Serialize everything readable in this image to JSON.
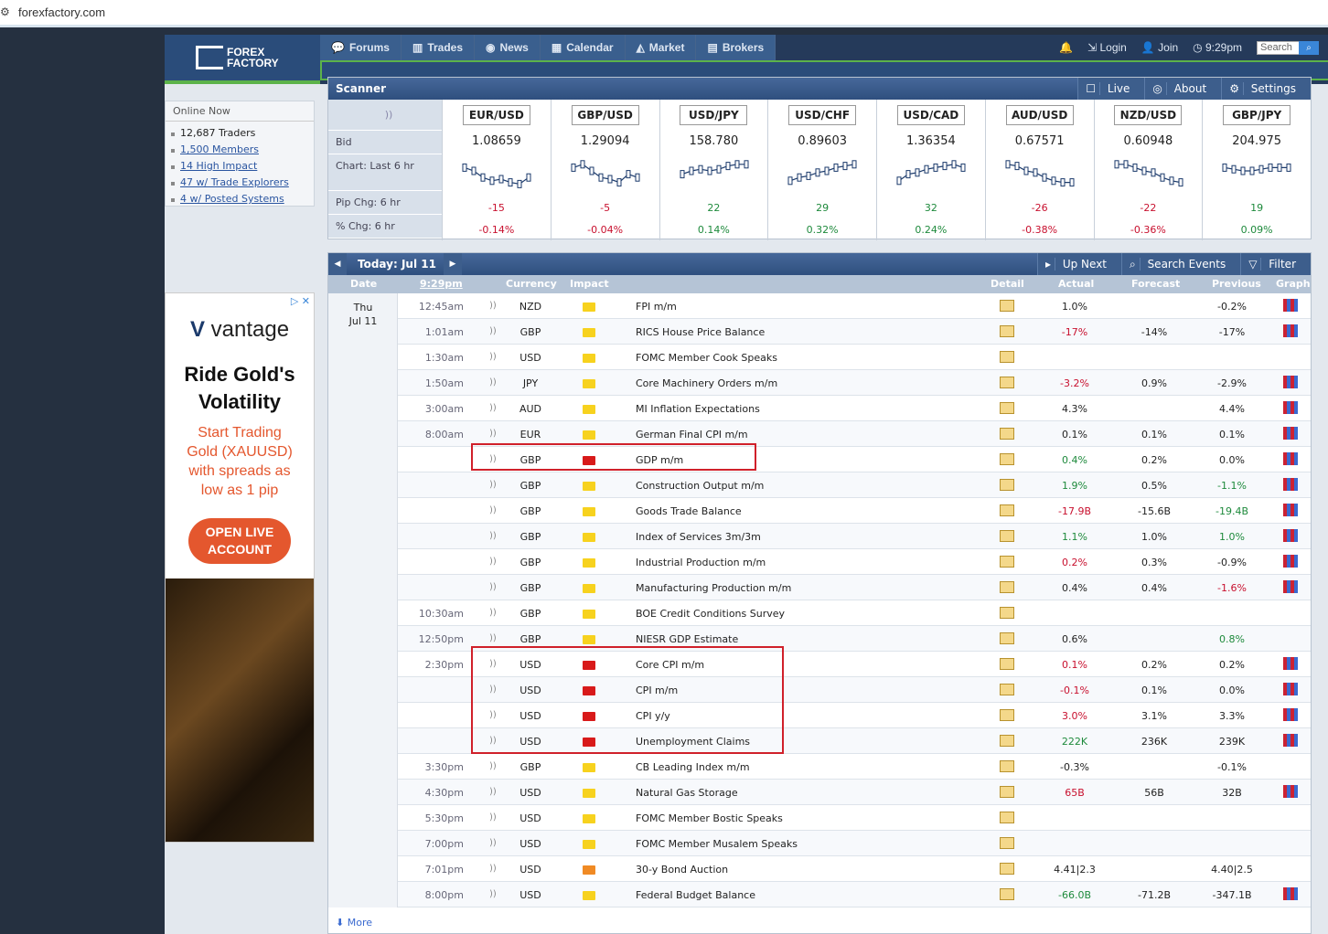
{
  "browser": {
    "url": "forexfactory.com"
  },
  "logo": {
    "line1": "FOREX",
    "line2": "FACTORY"
  },
  "nav": [
    {
      "label": "Forums",
      "icon": "chat-icon",
      "glyph": "💬"
    },
    {
      "label": "Trades",
      "icon": "bars-icon",
      "glyph": "▥"
    },
    {
      "label": "News",
      "icon": "globe-icon",
      "glyph": "◉"
    },
    {
      "label": "Calendar",
      "icon": "calendar-icon",
      "glyph": "▦"
    },
    {
      "label": "Market",
      "icon": "chart-icon",
      "glyph": "◭"
    },
    {
      "label": "Brokers",
      "icon": "brokers-icon",
      "glyph": "▤"
    }
  ],
  "user": {
    "login": "Login",
    "join": "Join",
    "time": "9:29pm",
    "search_placeholder": "Search"
  },
  "online": {
    "title": "Online Now",
    "items": [
      {
        "text": "12,687 Traders",
        "link": false
      },
      {
        "text": "1,500 Members",
        "link": true
      },
      {
        "text": "14 High Impact",
        "link": true
      },
      {
        "text": "47 w/ Trade Explorers",
        "link": true
      },
      {
        "text": "4 w/ Posted Systems",
        "link": true
      }
    ]
  },
  "ad": {
    "brand": "vantage",
    "headline1": "Ride Gold's",
    "headline2": "Volatility",
    "sub1": "Start Trading",
    "sub2": "Gold (XAUUSD)",
    "sub3": "with spreads as",
    "sub4": "low as 1 pip",
    "btn1": "OPEN LIVE",
    "btn2": "ACCOUNT"
  },
  "scanner": {
    "title": "Scanner",
    "live": "Live",
    "about": "About",
    "settings": "Settings",
    "labels": {
      "bid": "Bid",
      "chart": "Chart: Last 6 hr",
      "pip": "Pip Chg: 6 hr",
      "pct": "% Chg: 6 hr"
    },
    "pairs": [
      {
        "name": "EUR/USD",
        "bid": "1.08659",
        "pip": "-15",
        "pct": "-0.14%",
        "dir": "neg",
        "spark": [
          0.4,
          0.5,
          0.7,
          0.8,
          0.75,
          0.85,
          0.9,
          0.7
        ]
      },
      {
        "name": "GBP/USD",
        "bid": "1.29094",
        "pip": "-5",
        "pct": "-0.04%",
        "dir": "neg",
        "spark": [
          0.4,
          0.3,
          0.5,
          0.7,
          0.75,
          0.85,
          0.6,
          0.7
        ]
      },
      {
        "name": "USD/JPY",
        "bid": "158.780",
        "pip": "22",
        "pct": "0.14%",
        "dir": "pos",
        "spark": [
          0.6,
          0.5,
          0.45,
          0.5,
          0.45,
          0.35,
          0.3,
          0.3
        ]
      },
      {
        "name": "USD/CHF",
        "bid": "0.89603",
        "pip": "29",
        "pct": "0.32%",
        "dir": "pos",
        "spark": [
          0.8,
          0.7,
          0.65,
          0.55,
          0.5,
          0.4,
          0.35,
          0.3
        ]
      },
      {
        "name": "USD/CAD",
        "bid": "1.36354",
        "pip": "32",
        "pct": "0.24%",
        "dir": "pos",
        "spark": [
          0.8,
          0.6,
          0.55,
          0.45,
          0.4,
          0.35,
          0.3,
          0.4
        ]
      },
      {
        "name": "AUD/USD",
        "bid": "0.67571",
        "pip": "-26",
        "pct": "-0.38%",
        "dir": "neg",
        "spark": [
          0.3,
          0.35,
          0.5,
          0.55,
          0.7,
          0.8,
          0.85,
          0.85
        ]
      },
      {
        "name": "NZD/USD",
        "bid": "0.60948",
        "pip": "-22",
        "pct": "-0.36%",
        "dir": "neg",
        "spark": [
          0.3,
          0.3,
          0.4,
          0.5,
          0.55,
          0.7,
          0.8,
          0.85
        ]
      },
      {
        "name": "GBP/JPY",
        "bid": "204.975",
        "pip": "19",
        "pct": "0.09%",
        "dir": "pos",
        "spark": [
          0.4,
          0.45,
          0.5,
          0.5,
          0.45,
          0.4,
          0.4,
          0.4
        ]
      }
    ]
  },
  "calendar": {
    "today": "Today: Jul 11",
    "up_next": "Up Next",
    "search_events": "Search Events",
    "filter": "Filter",
    "more": "More",
    "cols": {
      "date": "Date",
      "time": "9:29pm",
      "currency": "Currency",
      "impact": "Impact",
      "detail": "Detail",
      "actual": "Actual",
      "forecast": "Forecast",
      "previous": "Previous",
      "graph": "Graph"
    },
    "date1": "Thu",
    "date2": "Jul 11",
    "rows": [
      {
        "time": "12:45am",
        "cur": "NZD",
        "imp": "low",
        "ev": "FPI m/m",
        "act": "1.0%",
        "actc": "",
        "fc": "",
        "pv": "-0.2%",
        "pvc": "",
        "gr": true
      },
      {
        "time": "1:01am",
        "cur": "GBP",
        "imp": "low",
        "ev": "RICS House Price Balance",
        "act": "-17%",
        "actc": "neg",
        "fc": "-14%",
        "pv": "-17%",
        "pvc": "",
        "gr": true
      },
      {
        "time": "1:30am",
        "cur": "USD",
        "imp": "low",
        "ev": "FOMC Member Cook Speaks",
        "act": "",
        "actc": "",
        "fc": "",
        "pv": "",
        "pvc": "",
        "gr": false
      },
      {
        "time": "1:50am",
        "cur": "JPY",
        "imp": "low",
        "ev": "Core Machinery Orders m/m",
        "act": "-3.2%",
        "actc": "neg",
        "fc": "0.9%",
        "pv": "-2.9%",
        "pvc": "",
        "gr": true
      },
      {
        "time": "3:00am",
        "cur": "AUD",
        "imp": "low",
        "ev": "MI Inflation Expectations",
        "act": "4.3%",
        "actc": "",
        "fc": "",
        "pv": "4.4%",
        "pvc": "",
        "gr": true
      },
      {
        "time": "8:00am",
        "cur": "EUR",
        "imp": "low",
        "ev": "German Final CPI m/m",
        "act": "0.1%",
        "actc": "",
        "fc": "0.1%",
        "pv": "0.1%",
        "pvc": "",
        "gr": true
      },
      {
        "time": "",
        "cur": "GBP",
        "imp": "high",
        "ev": "GDP m/m",
        "act": "0.4%",
        "actc": "pos",
        "fc": "0.2%",
        "pv": "0.0%",
        "pvc": "",
        "gr": true
      },
      {
        "time": "",
        "cur": "GBP",
        "imp": "low",
        "ev": "Construction Output m/m",
        "act": "1.9%",
        "actc": "pos",
        "fc": "0.5%",
        "pv": "-1.1%",
        "pvc": "pos",
        "gr": true
      },
      {
        "time": "",
        "cur": "GBP",
        "imp": "low",
        "ev": "Goods Trade Balance",
        "act": "-17.9B",
        "actc": "neg",
        "fc": "-15.6B",
        "pv": "-19.4B",
        "pvc": "pos",
        "gr": true
      },
      {
        "time": "",
        "cur": "GBP",
        "imp": "low",
        "ev": "Index of Services 3m/3m",
        "act": "1.1%",
        "actc": "pos",
        "fc": "1.0%",
        "pv": "1.0%",
        "pvc": "pos",
        "gr": true
      },
      {
        "time": "",
        "cur": "GBP",
        "imp": "low",
        "ev": "Industrial Production m/m",
        "act": "0.2%",
        "actc": "neg",
        "fc": "0.3%",
        "pv": "-0.9%",
        "pvc": "",
        "gr": true
      },
      {
        "time": "",
        "cur": "GBP",
        "imp": "low",
        "ev": "Manufacturing Production m/m",
        "act": "0.4%",
        "actc": "",
        "fc": "0.4%",
        "pv": "-1.6%",
        "pvc": "neg",
        "gr": true
      },
      {
        "time": "10:30am",
        "cur": "GBP",
        "imp": "low",
        "ev": "BOE Credit Conditions Survey",
        "act": "",
        "actc": "",
        "fc": "",
        "pv": "",
        "pvc": "",
        "gr": false
      },
      {
        "time": "12:50pm",
        "cur": "GBP",
        "imp": "low",
        "ev": "NIESR GDP Estimate",
        "act": "0.6%",
        "actc": "",
        "fc": "",
        "pv": "0.8%",
        "pvc": "pos",
        "gr": false
      },
      {
        "time": "2:30pm",
        "cur": "USD",
        "imp": "high",
        "ev": "Core CPI m/m",
        "act": "0.1%",
        "actc": "neg",
        "fc": "0.2%",
        "pv": "0.2%",
        "pvc": "",
        "gr": true
      },
      {
        "time": "",
        "cur": "USD",
        "imp": "high",
        "ev": "CPI m/m",
        "act": "-0.1%",
        "actc": "neg",
        "fc": "0.1%",
        "pv": "0.0%",
        "pvc": "",
        "gr": true
      },
      {
        "time": "",
        "cur": "USD",
        "imp": "high",
        "ev": "CPI y/y",
        "act": "3.0%",
        "actc": "neg",
        "fc": "3.1%",
        "pv": "3.3%",
        "pvc": "",
        "gr": true
      },
      {
        "time": "",
        "cur": "USD",
        "imp": "high",
        "ev": "Unemployment Claims",
        "act": "222K",
        "actc": "pos",
        "fc": "236K",
        "pv": "239K",
        "pvc": "",
        "gr": true
      },
      {
        "time": "3:30pm",
        "cur": "GBP",
        "imp": "low",
        "ev": "CB Leading Index m/m",
        "act": "-0.3%",
        "actc": "",
        "fc": "",
        "pv": "-0.1%",
        "pvc": "",
        "gr": false
      },
      {
        "time": "4:30pm",
        "cur": "USD",
        "imp": "low",
        "ev": "Natural Gas Storage",
        "act": "65B",
        "actc": "neg",
        "fc": "56B",
        "pv": "32B",
        "pvc": "",
        "gr": true
      },
      {
        "time": "5:30pm",
        "cur": "USD",
        "imp": "low",
        "ev": "FOMC Member Bostic Speaks",
        "act": "",
        "actc": "",
        "fc": "",
        "pv": "",
        "pvc": "",
        "gr": false
      },
      {
        "time": "7:00pm",
        "cur": "USD",
        "imp": "low",
        "ev": "FOMC Member Musalem Speaks",
        "act": "",
        "actc": "",
        "fc": "",
        "pv": "",
        "pvc": "",
        "gr": false
      },
      {
        "time": "7:01pm",
        "cur": "USD",
        "imp": "med",
        "ev": "30-y Bond Auction",
        "act": "4.41|2.3",
        "actc": "",
        "fc": "",
        "pv": "4.40|2.5",
        "pvc": "",
        "gr": false
      },
      {
        "time": "8:00pm",
        "cur": "USD",
        "imp": "low",
        "ev": "Federal Budget Balance",
        "act": "-66.0B",
        "actc": "pos",
        "fc": "-71.2B",
        "pv": "-347.1B",
        "pvc": "",
        "gr": true
      }
    ]
  }
}
